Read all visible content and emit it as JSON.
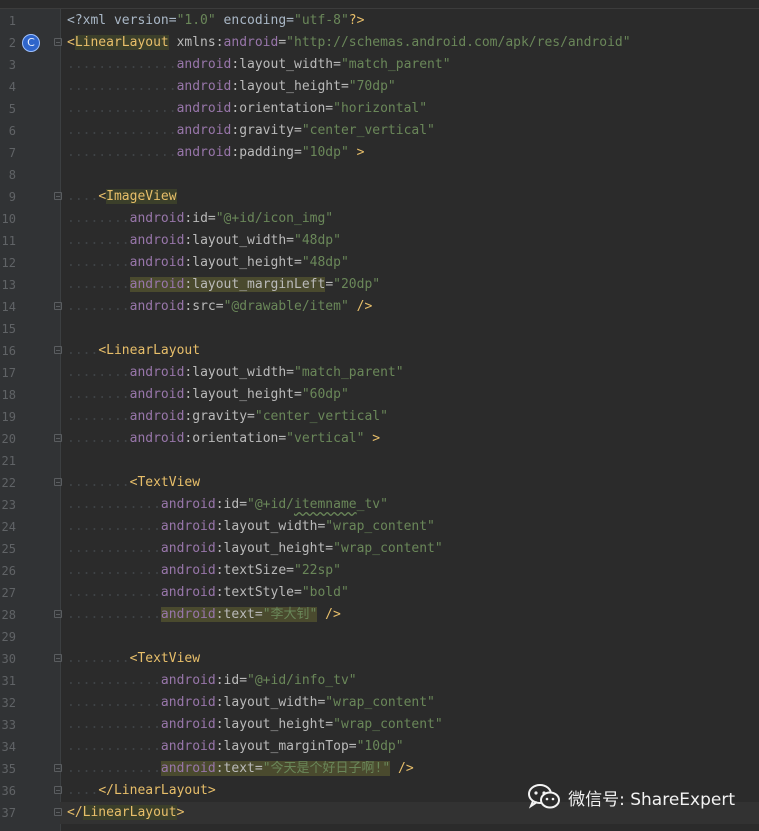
{
  "editor": {
    "current_line": 37,
    "badge_letter": "C",
    "lines": [
      {
        "n": "1",
        "dots": "",
        "tokens": [
          {
            "t": "<?xml version=",
            "c": "plain"
          },
          {
            "t": "\"1.0\"",
            "c": "val"
          },
          {
            "t": " encoding=",
            "c": "plain"
          },
          {
            "t": "\"utf-8\"",
            "c": "val"
          },
          {
            "t": "?>",
            "c": "pi"
          }
        ]
      },
      {
        "n": "2",
        "dots": "",
        "tokens": [
          {
            "t": "<",
            "c": "br"
          },
          {
            "t": "LinearLayout",
            "c": "tag hl"
          },
          {
            "t": " xmlns",
            "c": "attr"
          },
          {
            "t": ":",
            "c": "attr"
          },
          {
            "t": "android",
            "c": "ns"
          },
          {
            "t": "=",
            "c": "attr"
          },
          {
            "t": "\"http://schemas.android.com/apk/res/android\"",
            "c": "val"
          }
        ]
      },
      {
        "n": "3",
        "dots": "..............",
        "tokens": [
          {
            "t": "android",
            "c": "ns"
          },
          {
            "t": ":layout_width=",
            "c": "attr"
          },
          {
            "t": "\"match_parent\"",
            "c": "val"
          }
        ]
      },
      {
        "n": "4",
        "dots": "..............",
        "tokens": [
          {
            "t": "android",
            "c": "ns"
          },
          {
            "t": ":layout_height=",
            "c": "attr"
          },
          {
            "t": "\"70dp\"",
            "c": "val"
          }
        ]
      },
      {
        "n": "5",
        "dots": "..............",
        "tokens": [
          {
            "t": "android",
            "c": "ns"
          },
          {
            "t": ":orientation=",
            "c": "attr"
          },
          {
            "t": "\"horizontal\"",
            "c": "val"
          }
        ]
      },
      {
        "n": "6",
        "dots": "..............",
        "tokens": [
          {
            "t": "android",
            "c": "ns"
          },
          {
            "t": ":gravity=",
            "c": "attr"
          },
          {
            "t": "\"center_vertical\"",
            "c": "val"
          }
        ]
      },
      {
        "n": "7",
        "dots": "..............",
        "tokens": [
          {
            "t": "android",
            "c": "ns"
          },
          {
            "t": ":padding=",
            "c": "attr"
          },
          {
            "t": "\"10dp\"",
            "c": "val"
          },
          {
            "t": " >",
            "c": "br"
          }
        ]
      },
      {
        "n": "8",
        "dots": "",
        "tokens": []
      },
      {
        "n": "9",
        "dots": "....",
        "tokens": [
          {
            "t": "<",
            "c": "br"
          },
          {
            "t": "ImageView",
            "c": "tag hl"
          }
        ]
      },
      {
        "n": "10",
        "dots": "........",
        "tokens": [
          {
            "t": "android",
            "c": "ns"
          },
          {
            "t": ":id=",
            "c": "attr"
          },
          {
            "t": "\"@+id/icon_img\"",
            "c": "val"
          }
        ]
      },
      {
        "n": "11",
        "dots": "........",
        "tokens": [
          {
            "t": "android",
            "c": "ns"
          },
          {
            "t": ":layout_width=",
            "c": "attr"
          },
          {
            "t": "\"48dp\"",
            "c": "val"
          }
        ]
      },
      {
        "n": "12",
        "dots": "........",
        "tokens": [
          {
            "t": "android",
            "c": "ns"
          },
          {
            "t": ":layout_height=",
            "c": "attr"
          },
          {
            "t": "\"48dp\"",
            "c": "val"
          }
        ]
      },
      {
        "n": "13",
        "dots": "........",
        "tokens": [
          {
            "t": "android",
            "c": "ns hl2"
          },
          {
            "t": ":layout_marginLeft",
            "c": "attr hl2"
          },
          {
            "t": "=",
            "c": "attr"
          },
          {
            "t": "\"20dp\"",
            "c": "val"
          }
        ]
      },
      {
        "n": "14",
        "dots": "........",
        "tokens": [
          {
            "t": "android",
            "c": "ns"
          },
          {
            "t": ":src=",
            "c": "attr"
          },
          {
            "t": "\"@drawable/item\"",
            "c": "val"
          },
          {
            "t": " />",
            "c": "br"
          }
        ]
      },
      {
        "n": "15",
        "dots": "",
        "tokens": []
      },
      {
        "n": "16",
        "dots": "....",
        "tokens": [
          {
            "t": "<",
            "c": "br"
          },
          {
            "t": "LinearLayout",
            "c": "tag"
          }
        ]
      },
      {
        "n": "17",
        "dots": "........",
        "tokens": [
          {
            "t": "android",
            "c": "ns"
          },
          {
            "t": ":layout_width=",
            "c": "attr"
          },
          {
            "t": "\"match_parent\"",
            "c": "val"
          }
        ]
      },
      {
        "n": "18",
        "dots": "........",
        "tokens": [
          {
            "t": "android",
            "c": "ns"
          },
          {
            "t": ":layout_height=",
            "c": "attr"
          },
          {
            "t": "\"60dp\"",
            "c": "val"
          }
        ]
      },
      {
        "n": "19",
        "dots": "........",
        "tokens": [
          {
            "t": "android",
            "c": "ns"
          },
          {
            "t": ":gravity=",
            "c": "attr"
          },
          {
            "t": "\"center_vertical\"",
            "c": "val"
          }
        ]
      },
      {
        "n": "20",
        "dots": "........",
        "tokens": [
          {
            "t": "android",
            "c": "ns"
          },
          {
            "t": ":orientation=",
            "c": "attr"
          },
          {
            "t": "\"vertical\"",
            "c": "val"
          },
          {
            "t": " >",
            "c": "br"
          }
        ]
      },
      {
        "n": "21",
        "dots": "",
        "tokens": []
      },
      {
        "n": "22",
        "dots": "........",
        "tokens": [
          {
            "t": "<",
            "c": "br"
          },
          {
            "t": "TextView",
            "c": "tag"
          }
        ]
      },
      {
        "n": "23",
        "dots": "............",
        "tokens": [
          {
            "t": "android",
            "c": "ns"
          },
          {
            "t": ":id=",
            "c": "attr"
          },
          {
            "t": "\"@+id/",
            "c": "val"
          },
          {
            "t": "itemname",
            "c": "val squiggle"
          },
          {
            "t": "_tv\"",
            "c": "val"
          }
        ]
      },
      {
        "n": "24",
        "dots": "............",
        "tokens": [
          {
            "t": "android",
            "c": "ns"
          },
          {
            "t": ":layout_width=",
            "c": "attr"
          },
          {
            "t": "\"wrap_content\"",
            "c": "val"
          }
        ]
      },
      {
        "n": "25",
        "dots": "............",
        "tokens": [
          {
            "t": "android",
            "c": "ns"
          },
          {
            "t": ":layout_height=",
            "c": "attr"
          },
          {
            "t": "\"wrap_content\"",
            "c": "val"
          }
        ]
      },
      {
        "n": "26",
        "dots": "............",
        "tokens": [
          {
            "t": "android",
            "c": "ns"
          },
          {
            "t": ":textSize=",
            "c": "attr"
          },
          {
            "t": "\"22sp\"",
            "c": "val"
          }
        ]
      },
      {
        "n": "27",
        "dots": "............",
        "tokens": [
          {
            "t": "android",
            "c": "ns"
          },
          {
            "t": ":textStyle=",
            "c": "attr"
          },
          {
            "t": "\"bold\"",
            "c": "val"
          }
        ]
      },
      {
        "n": "28",
        "dots": "............",
        "tokens": [
          {
            "t": "android",
            "c": "ns hl2"
          },
          {
            "t": ":text=",
            "c": "attr hl2"
          },
          {
            "t": "\"李大钊\"",
            "c": "val hl2"
          },
          {
            "t": " />",
            "c": "br"
          }
        ]
      },
      {
        "n": "29",
        "dots": "",
        "tokens": []
      },
      {
        "n": "30",
        "dots": "........",
        "tokens": [
          {
            "t": "<",
            "c": "br"
          },
          {
            "t": "TextView",
            "c": "tag"
          }
        ]
      },
      {
        "n": "31",
        "dots": "............",
        "tokens": [
          {
            "t": "android",
            "c": "ns"
          },
          {
            "t": ":id=",
            "c": "attr"
          },
          {
            "t": "\"@+id/info_tv\"",
            "c": "val"
          }
        ]
      },
      {
        "n": "32",
        "dots": "............",
        "tokens": [
          {
            "t": "android",
            "c": "ns"
          },
          {
            "t": ":layout_width=",
            "c": "attr"
          },
          {
            "t": "\"wrap_content\"",
            "c": "val"
          }
        ]
      },
      {
        "n": "33",
        "dots": "............",
        "tokens": [
          {
            "t": "android",
            "c": "ns"
          },
          {
            "t": ":layout_height=",
            "c": "attr"
          },
          {
            "t": "\"wrap_content\"",
            "c": "val"
          }
        ]
      },
      {
        "n": "34",
        "dots": "............",
        "tokens": [
          {
            "t": "android",
            "c": "ns"
          },
          {
            "t": ":layout_marginTop=",
            "c": "attr"
          },
          {
            "t": "\"10dp\"",
            "c": "val"
          }
        ]
      },
      {
        "n": "35",
        "dots": "............",
        "tokens": [
          {
            "t": "android",
            "c": "ns hl2"
          },
          {
            "t": ":text=",
            "c": "attr hl2"
          },
          {
            "t": "\"今天是个好日子啊!\"",
            "c": "val hl2"
          },
          {
            "t": " />",
            "c": "br"
          }
        ]
      },
      {
        "n": "36",
        "dots": "....",
        "tokens": [
          {
            "t": "</",
            "c": "br"
          },
          {
            "t": "LinearLayout",
            "c": "tag"
          },
          {
            "t": ">",
            "c": "br"
          }
        ]
      },
      {
        "n": "37",
        "dots": "",
        "tokens": [
          {
            "t": "</",
            "c": "br"
          },
          {
            "t": "LinearLayout",
            "c": "tag hl"
          },
          {
            "t": ">",
            "c": "br"
          }
        ]
      }
    ],
    "folds": [
      "2",
      "9",
      "14",
      "16",
      "20",
      "22",
      "28",
      "30",
      "35",
      "36",
      "37"
    ]
  },
  "watermark": {
    "text": "微信号: ShareExpert",
    "icon": "wechat-icon"
  }
}
